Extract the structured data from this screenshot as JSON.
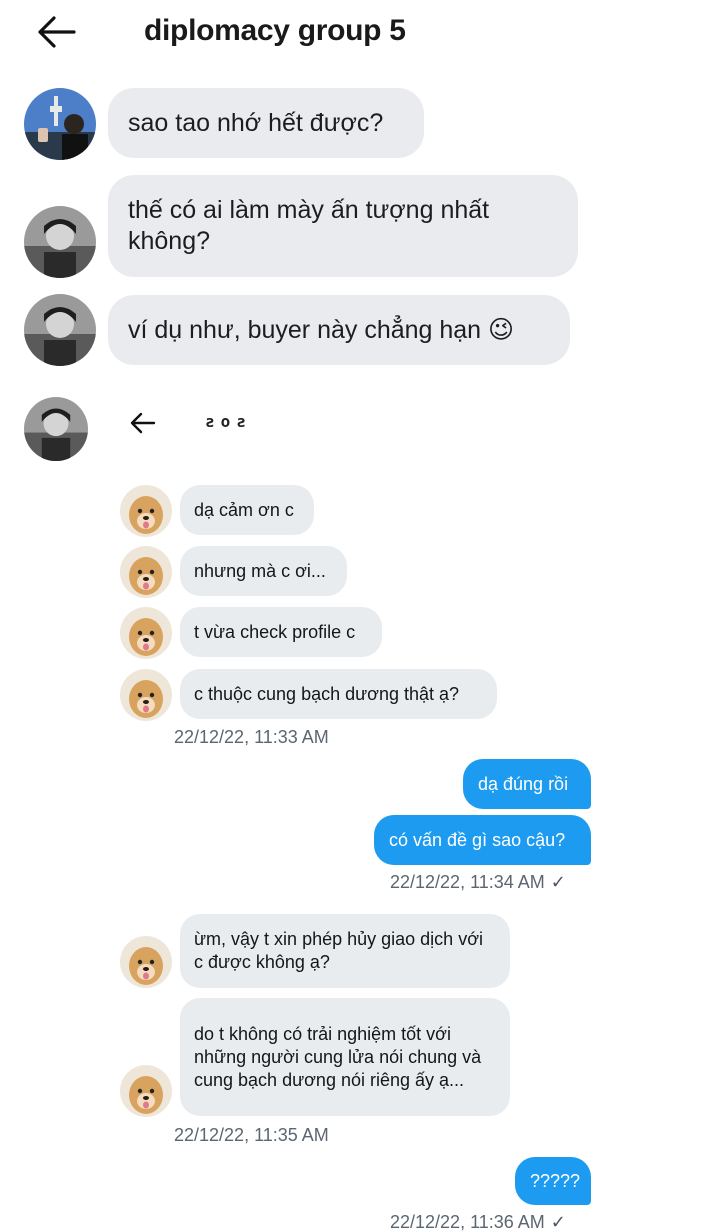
{
  "header": {
    "title": "diplomacy group 5",
    "back_icon": "arrow-left-icon"
  },
  "outer_messages": [
    {
      "sender": "avatar-1",
      "text": "sao tao nhớ hết được?"
    },
    {
      "sender": "avatar-2",
      "text": "thế có ai làm mày ấn tượng nhất không?"
    },
    {
      "sender": "avatar-2",
      "text": "ví dụ như, buyer này chẳng hạn 😉"
    }
  ],
  "embedded_screenshot": {
    "back_icon": "arrow-left-icon",
    "title": "ƨoƨ",
    "messages": [
      {
        "side": "in",
        "text": "dạ cảm ơn c"
      },
      {
        "side": "in",
        "text": "nhưng mà c ơi..."
      },
      {
        "side": "in",
        "text": "t vừa check profile c"
      },
      {
        "side": "in",
        "text": "c thuộc cung bạch dương thật ạ?"
      },
      {
        "side": "in-ts",
        "text": "22/12/22, 11:33 AM"
      },
      {
        "side": "out",
        "text": "dạ đúng rồi"
      },
      {
        "side": "out",
        "text": "có vấn đề gì sao cậu?"
      },
      {
        "side": "out-ts",
        "text": "22/12/22, 11:34 AM"
      },
      {
        "side": "in",
        "text": "ừm, vậy t xin phép hủy giao dịch với c được không ạ?"
      },
      {
        "side": "in",
        "text": "do t không có trải nghiệm tốt với những người cung lửa nói chung và cung bạch dương nói riêng ấy ạ..."
      },
      {
        "side": "in-ts",
        "text": "22/12/22, 11:35 AM"
      },
      {
        "side": "out",
        "text": "?????"
      },
      {
        "side": "out-ts",
        "text": "22/12/22, 11:36 AM"
      }
    ],
    "read_check": "✓"
  },
  "colors": {
    "sent_bubble": "#1d9bf0",
    "received_bubble": "#e9ecef",
    "timestamp": "#5b6671"
  }
}
